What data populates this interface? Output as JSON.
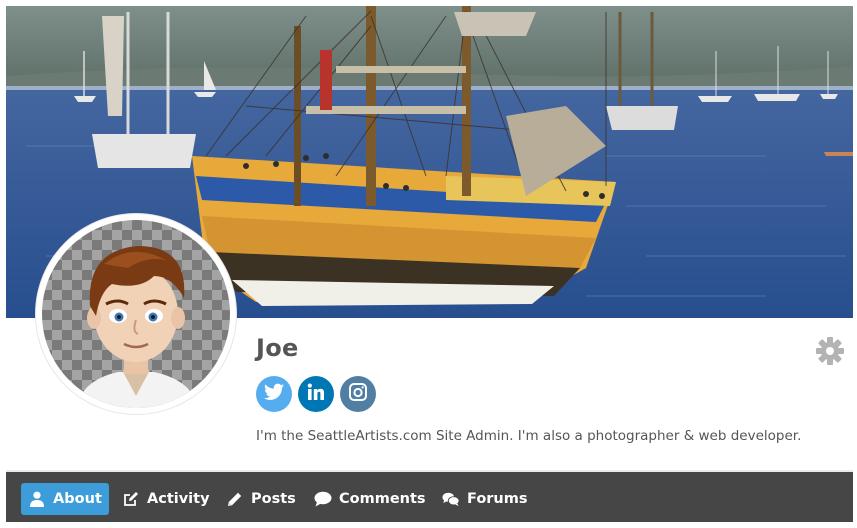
{
  "profile": {
    "name": "Joe",
    "bio": "I'm the SeattleArtists.com Site Admin. I'm also a photographer & web developer."
  },
  "social": [
    {
      "name": "twitter",
      "icon": "twitter-icon",
      "color": "#55acee"
    },
    {
      "name": "linkedin",
      "icon": "linkedin-icon",
      "color": "#0077b5"
    },
    {
      "name": "instagram",
      "icon": "instagram-icon",
      "color": "#517fa4"
    }
  ],
  "settings": {
    "icon": "gear-icon",
    "color": "#b3b3b3"
  },
  "nav": {
    "items": [
      {
        "label": "About",
        "icon": "user-icon",
        "active": true
      },
      {
        "label": "Activity",
        "icon": "edit-icon",
        "active": false
      },
      {
        "label": "Posts",
        "icon": "pencil-icon",
        "active": false
      },
      {
        "label": "Comments",
        "icon": "comment-icon",
        "active": false
      },
      {
        "label": "Forums",
        "icon": "comments-icon",
        "active": false
      }
    ],
    "active_color": "#3d9ddb",
    "bar_color": "#464646"
  }
}
